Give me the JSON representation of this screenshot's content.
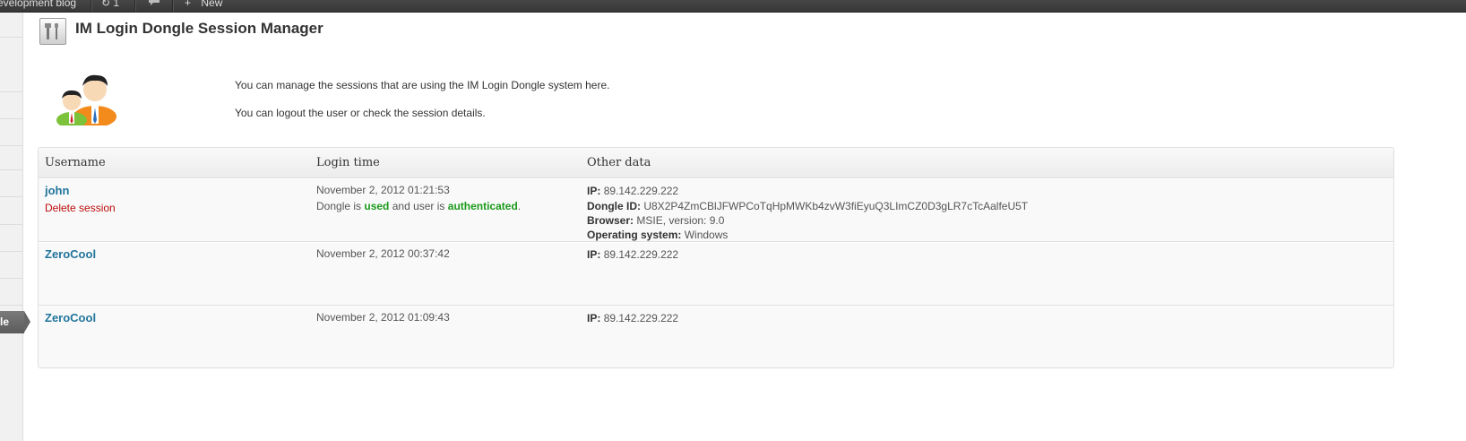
{
  "adminbar": {
    "site_name": "evelopment blog",
    "updates": "1",
    "new_label": "New"
  },
  "sidebar": {
    "current_label": "le"
  },
  "page": {
    "title": "IM Login Dongle Session Manager",
    "intro_line1": "You can manage the sessions that are using the IM Login Dongle system here.",
    "intro_line2": "You can logout the user or check the session details."
  },
  "table": {
    "headers": [
      "Username",
      "Login time",
      "Other data"
    ],
    "rows": [
      {
        "username": "john",
        "delete_label": "Delete session",
        "login_time": "November 2, 2012 01:21:53",
        "dongle_prefix": "Dongle is ",
        "dongle_used": "used",
        "dongle_mid": " and user is ",
        "dongle_auth": "authenticated",
        "dongle_end": ".",
        "ip_label": "IP:",
        "ip": "89.142.229.222",
        "dongle_id_label": "Dongle ID:",
        "dongle_id": "U8X2P4ZmCBlJFWPCoTqHpMWKb4zvW3fiEyuQ3LImCZ0D3gLR7cTcAalfeU5T",
        "browser_label": "Browser:",
        "browser": "MSIE, version: 9.0",
        "os_label": "Operating system:",
        "os": "Windows"
      },
      {
        "username": "ZeroCool",
        "login_time": "November 2, 2012 00:37:42",
        "ip_label": "IP:",
        "ip": "89.142.229.222"
      },
      {
        "username": "ZeroCool",
        "login_time": "November 2, 2012 01:09:43",
        "ip_label": "IP:",
        "ip": "89.142.229.222"
      }
    ]
  },
  "colors": {
    "link": "#21759b",
    "delete": "#bc0b0b",
    "status_green": "#1b9a1b"
  },
  "icons": {
    "page_icon": "tools-icon",
    "people_image": "users-icon"
  }
}
